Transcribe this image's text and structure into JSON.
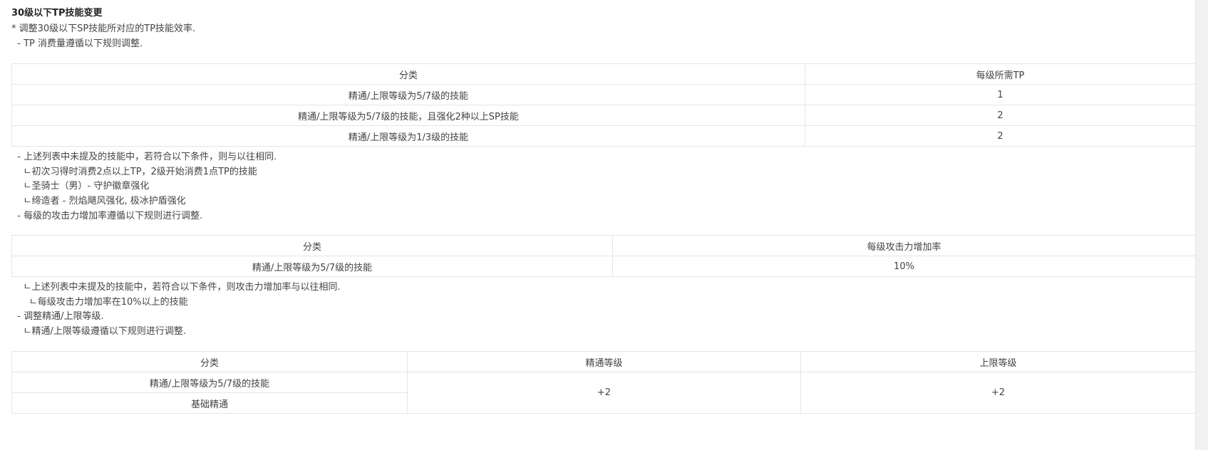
{
  "title": "30级以下TP技能变更",
  "intro": [
    "* 调整30级以下SP技能所对应的TP技能效率.",
    "  - TP 消费量遵循以下规则调整."
  ],
  "table1": {
    "headers": [
      "分类",
      "每级所需TP"
    ],
    "rows": [
      [
        "精通/上限等级为5/7级的技能",
        "1"
      ],
      [
        "精通/上限等级为5/7级的技能，且强化2种以上SP技能",
        "2"
      ],
      [
        "精通/上限等级为1/3级的技能",
        "2"
      ]
    ]
  },
  "notes1": [
    "  - 上述列表中未提及的技能中，若符合以下条件，则与以往相同.",
    "    ㄴ初次习得时消费2点以上TP，2级开始消费1点TP的技能",
    "    ㄴ圣骑士（男）- 守护徽章强化",
    "    ㄴ缔造者 - 烈焰飓风强化, 极冰护盾强化",
    "  - 每级的攻击力增加率遵循以下规则进行调整."
  ],
  "table2": {
    "headers": [
      "分类",
      "每级攻击力增加率"
    ],
    "rows": [
      [
        "精通/上限等级为5/7级的技能",
        "10%"
      ]
    ]
  },
  "notes2": [
    "    ㄴ上述列表中未提及的技能中，若符合以下条件，则攻击力增加率与以往相同.",
    "      ㄴ每级攻击力增加率在10%以上的技能",
    "  - 调整精通/上限等级.",
    "    ㄴ精通/上限等级遵循以下规则进行调整."
  ],
  "table3": {
    "headers": [
      "分类",
      "精通等级",
      "上限等级"
    ],
    "row_labels": [
      "精通/上限等级为5/7级的技能",
      "基础精通"
    ],
    "mastery_value": "+2",
    "limit_value": "+2"
  }
}
